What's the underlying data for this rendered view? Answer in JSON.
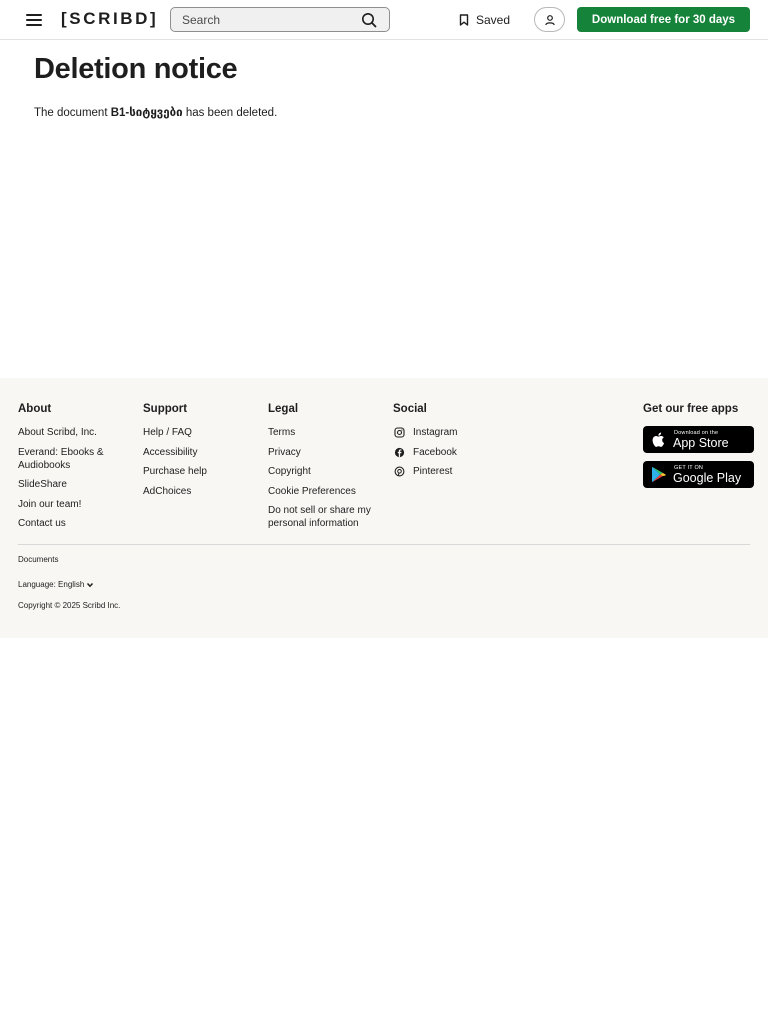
{
  "header": {
    "logo": "[SCRIBD]",
    "search_placeholder": "Search",
    "saved_label": "Saved",
    "download_label": "Download free for 30 days"
  },
  "main": {
    "title": "Deletion notice",
    "notice_prefix": "The document ",
    "document_name": "B1-სიტყვები",
    "notice_suffix": " has been deleted."
  },
  "footer": {
    "about": {
      "heading": "About",
      "links": [
        "About Scribd, Inc.",
        "Everand: Ebooks & Audiobooks",
        "SlideShare",
        "Join our team!",
        "Contact us"
      ]
    },
    "support": {
      "heading": "Support",
      "links": [
        "Help / FAQ",
        "Accessibility",
        "Purchase help",
        "AdChoices"
      ]
    },
    "legal": {
      "heading": "Legal",
      "links": [
        "Terms",
        "Privacy",
        "Copyright",
        "Cookie Preferences",
        "Do not sell or share my personal information"
      ]
    },
    "social": {
      "heading": "Social",
      "links": [
        "Instagram",
        "Facebook",
        "Pinterest"
      ]
    },
    "apps": {
      "heading": "Get our free apps",
      "app_store_small": "Download on the",
      "app_store_big": "App Store",
      "google_small": "GET IT ON",
      "google_big": "Google Play"
    },
    "documents_label": "Documents",
    "language_label": "Language: English",
    "copyright": "Copyright © 2025 Scribd Inc."
  },
  "colors": {
    "brand_green": "#16833a",
    "footer_bg": "#f8f7f4"
  }
}
